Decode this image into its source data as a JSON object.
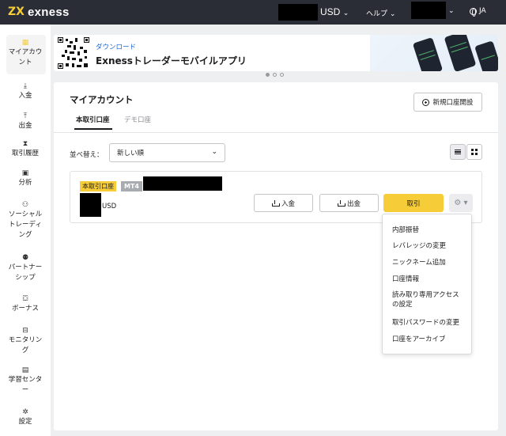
{
  "topbar": {
    "logo_mark": "ZX",
    "logo_text": "exness",
    "currency": "USD",
    "help_label": "ヘルプ",
    "chevron": "⌄",
    "language": "JA",
    "icons": [
      "chevron-down-icon",
      "globe-icon"
    ]
  },
  "sidebar": {
    "items": [
      {
        "label": "マイアカウ\nント",
        "icon": "grid-icon",
        "glyph": "▦"
      },
      {
        "label": "入金",
        "icon": "download-icon",
        "glyph": "⤓"
      },
      {
        "label": "出金",
        "icon": "upload-icon",
        "glyph": "⤒"
      },
      {
        "label": "取引履歴",
        "icon": "hourglass-icon",
        "glyph": "⧗"
      },
      {
        "label": "分析",
        "icon": "chart-icon",
        "glyph": "▣"
      },
      {
        "label": "ソーシャル\nトレーディ\nング",
        "icon": "people-icon",
        "glyph": "⚇"
      },
      {
        "label": "パートナー\nシップ",
        "icon": "partners-icon",
        "glyph": "⚉"
      },
      {
        "label": "ボーナス",
        "icon": "gift-icon",
        "glyph": "⛋"
      },
      {
        "label": "モニタリン\nグ",
        "icon": "briefcase-icon",
        "glyph": "⊟"
      },
      {
        "label": "学習センタ\nー",
        "icon": "book-icon",
        "glyph": "▤"
      },
      {
        "label": "設定",
        "icon": "gear-icon",
        "glyph": "✲"
      }
    ]
  },
  "banner": {
    "subtitle": "ダウンロード",
    "title": "Exnessトレーダーモバイルアプリ"
  },
  "main": {
    "title": "マイアカウント",
    "new_account_label": "新規口座開設",
    "tabs": [
      {
        "label": "本取引口座",
        "active": true
      },
      {
        "label": "デモ口座",
        "active": false
      }
    ],
    "sort_label": "並べ替え：",
    "sort_value": "新しい順",
    "view_mode": "list"
  },
  "account": {
    "type_badge": "本取引口座",
    "platform_badge": "MT4",
    "currency": "USD",
    "deposit_label": "入金",
    "withdraw_label": "出金",
    "trade_label": "取引",
    "gear_glyph": "⚙ ▾"
  },
  "menu": {
    "items": [
      "内部振替",
      "レバレッジの変更",
      "ニックネーム追加",
      "口座情報",
      "読み取り専用アクセス\nの設定",
      "取引パスワードの変更",
      "口座をアーカイブ"
    ]
  },
  "colors": {
    "accent": "#f6cd38",
    "topbar": "#2a2d35",
    "link": "#1a66d6"
  }
}
